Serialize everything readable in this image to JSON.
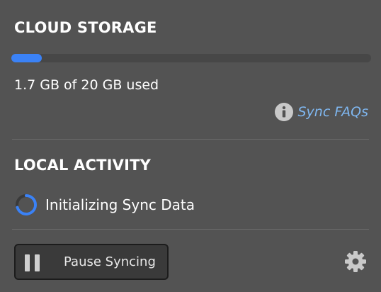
{
  "cloud_storage": {
    "title": "CLOUD STORAGE",
    "used_fraction": 0.085,
    "usage_text": "1.7 GB of 20 GB used",
    "faq_label": "Sync FAQs"
  },
  "local_activity": {
    "title": "LOCAL ACTIVITY",
    "status_text": "Initializing Sync Data"
  },
  "footer": {
    "pause_label": "Pause Syncing"
  },
  "icons": {
    "info": "info-icon",
    "spinner": "spinner-icon",
    "pause": "pause-icon",
    "settings": "gear-icon"
  },
  "colors": {
    "background": "#535353",
    "accent": "#3b82f6",
    "link": "#7fb7f0"
  }
}
